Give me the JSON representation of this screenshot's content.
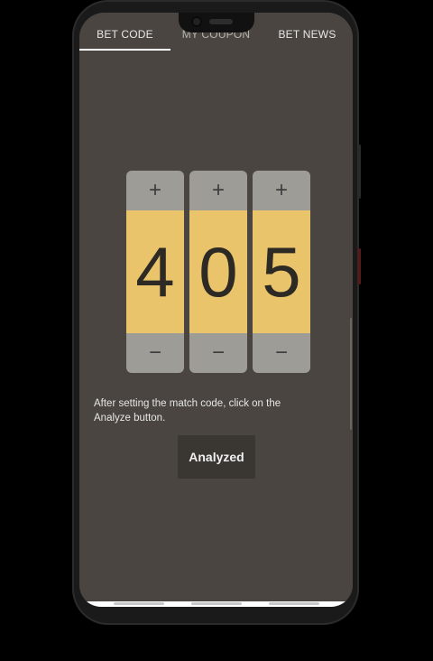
{
  "tabs": [
    {
      "label": "BET CODE",
      "active": true
    },
    {
      "label": "MY COUPON",
      "active": false
    },
    {
      "label": "BET NEWS",
      "active": false
    }
  ],
  "reels": {
    "plus_symbol": "+",
    "minus_symbol": "−",
    "digits": [
      "4",
      "0",
      "5"
    ]
  },
  "instructions": "After setting the match code, click on the Analyze button.",
  "analyze_button": "Analyzed",
  "colors": {
    "background": "#4a4540",
    "digit_panel": "#e9c46a",
    "control_panel": "#9d9c97",
    "button": "#3a3631"
  }
}
